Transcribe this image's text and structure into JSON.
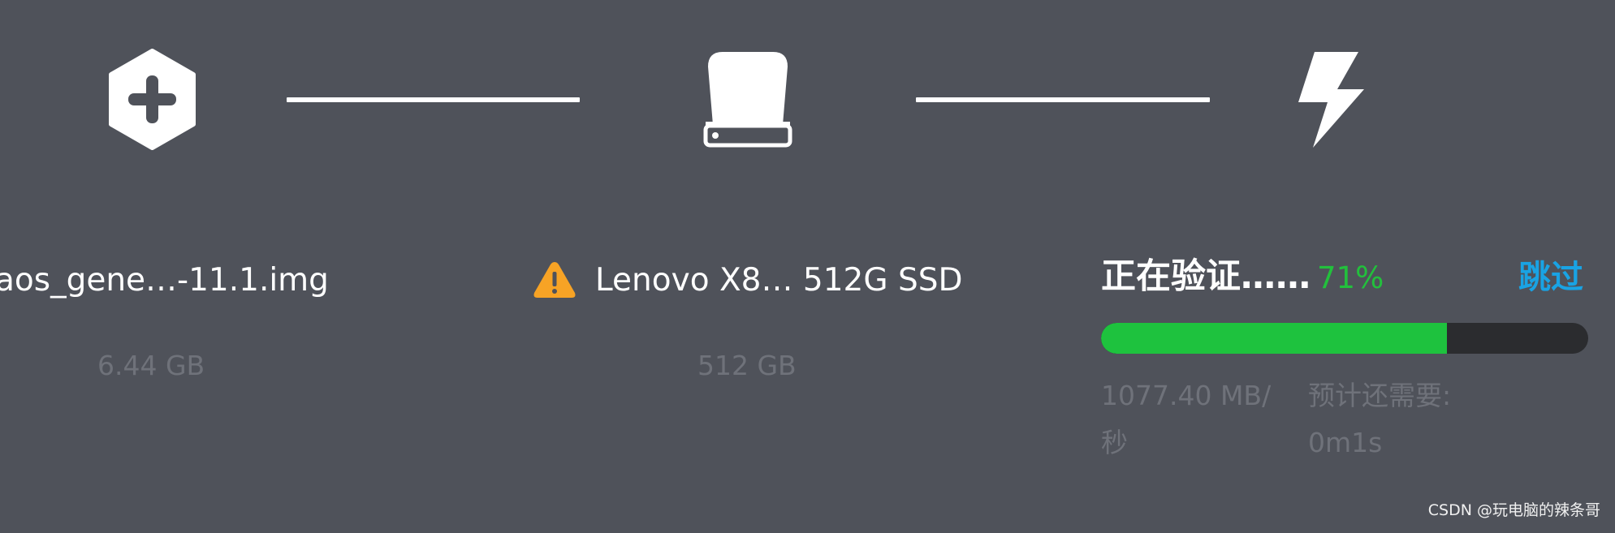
{
  "steps": [
    {
      "id": "image",
      "icon": "plus-hexagon-icon"
    },
    {
      "id": "drive",
      "icon": "hard-drive-icon"
    },
    {
      "id": "flash",
      "icon": "lightning-bolt-icon"
    }
  ],
  "image": {
    "name": "aos_gene…-11.1.img",
    "size": "6.44 GB"
  },
  "drive": {
    "name": "Lenovo X8… 512G SSD",
    "size": "512 GB",
    "warning_icon": "warning-triangle-icon"
  },
  "flash": {
    "status": "正在验证……",
    "percent_text": "71%",
    "progress": 0.71,
    "skip_label": "跳过",
    "speed": "1077.40 MB/秒",
    "eta_label": "预计还需要:",
    "eta_value": "0m1s"
  },
  "watermark": "CSDN @玩电脑的辣条哥",
  "colors": {
    "background": "#4f525a",
    "progress_fill": "#1ec23e",
    "progress_track": "#2b2c2f",
    "percent": "#22c03c",
    "skip_link": "#19a3e4",
    "warning": "#f7a325",
    "muted_text": "#6f727a"
  }
}
